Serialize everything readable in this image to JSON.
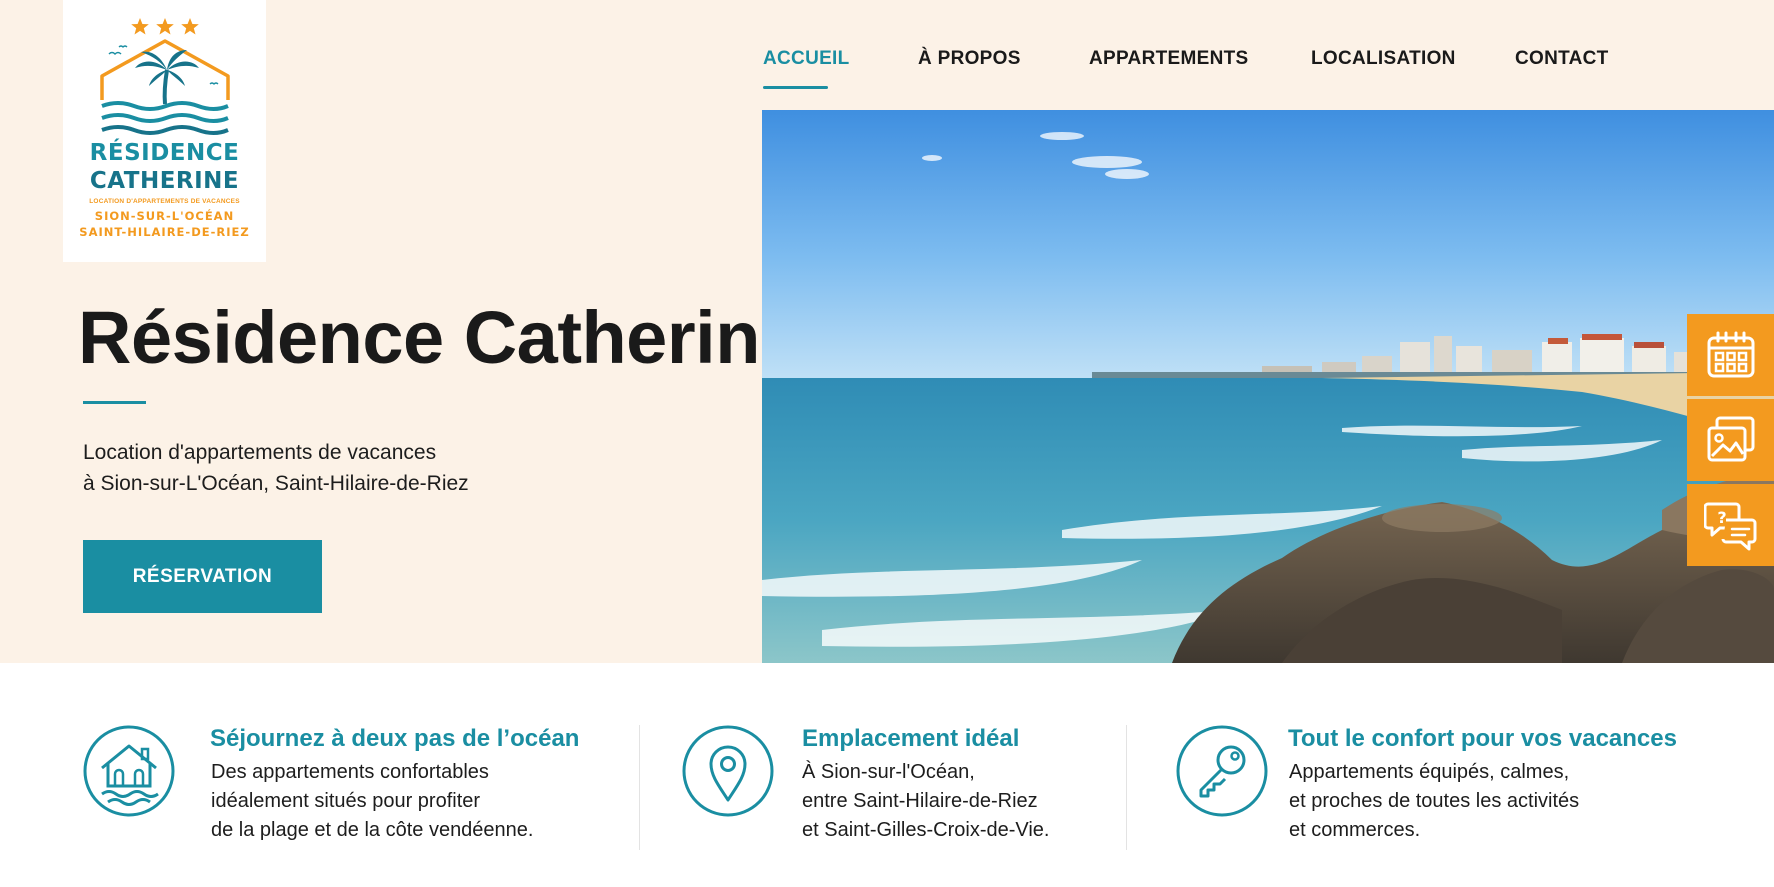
{
  "logo": {
    "line1": "RÉSIDENCE",
    "line2": "CATHERINE",
    "tagline": "LOCATION D'APPARTEMENTS DE VACANCES",
    "place1": "SION-SUR-L'OCÉAN",
    "place2": "SAINT-HILAIRE-DE-RIEZ",
    "stars": 3,
    "colors": {
      "teal": "#1a8ea2",
      "orange": "#f39a1f"
    }
  },
  "nav": {
    "items": [
      {
        "label": "ACCUEIL",
        "active": true
      },
      {
        "label": "À PROPOS",
        "active": false
      },
      {
        "label": "APPARTEMENTS",
        "active": false
      },
      {
        "label": "LOCALISATION",
        "active": false
      },
      {
        "label": "CONTACT",
        "active": false
      }
    ]
  },
  "hero": {
    "title": "Résidence Catherine",
    "subtitle_line1": "Location d'appartements de vacances",
    "subtitle_line2": "à Sion-sur-L'Océan, Saint-Hilaire-de-Riez",
    "cta_label": "RÉSERVATION"
  },
  "side_tabs": [
    {
      "icon": "calendar-icon"
    },
    {
      "icon": "gallery-icon"
    },
    {
      "icon": "chat-question-icon"
    }
  ],
  "features": [
    {
      "icon": "house-waves-icon",
      "title": "Séjournez à deux pas de l’océan",
      "lines": [
        "Des appartements confortables",
        "idéalement situés pour profiter",
        "de la plage et de la côte vendéenne."
      ]
    },
    {
      "icon": "location-pin-icon",
      "title": "Emplacement idéal",
      "lines": [
        "À Sion-sur-l'Océan,",
        "entre Saint-Hilaire-de-Riez",
        "et Saint-Gilles-Croix-de-Vie."
      ]
    },
    {
      "icon": "key-icon",
      "title": "Tout le confort pour vos vacances",
      "lines": [
        "Appartements équipés, calmes,",
        "et proches de toutes les activités",
        "et commerces."
      ]
    }
  ],
  "colors": {
    "accent": "#1a8ea2",
    "orange": "#f39a1f",
    "hero_bg": "#fcf2e7"
  }
}
